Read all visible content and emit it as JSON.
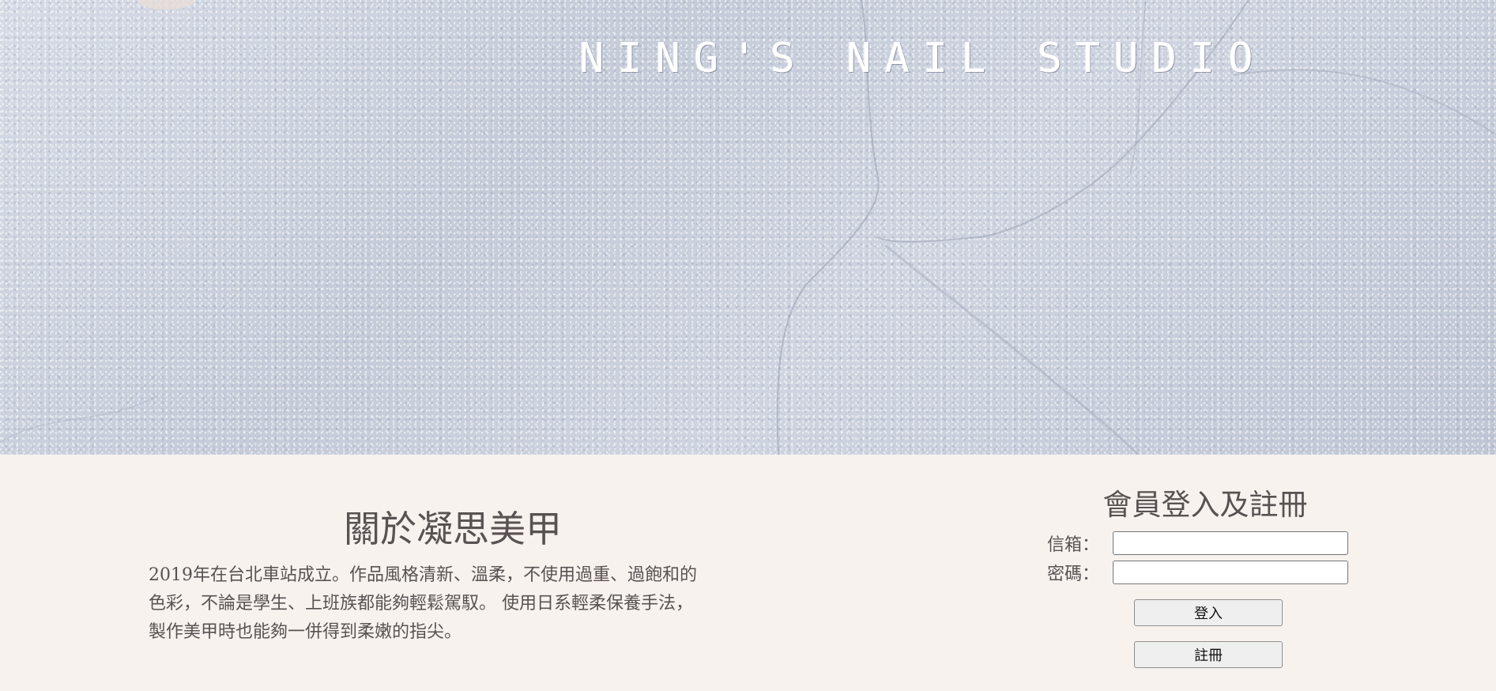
{
  "hero": {
    "title": "NING'S NAIL STUDIO"
  },
  "about": {
    "title": "關於凝思美甲",
    "text_lines": [
      "2019年在台北車站成立。作品風格清新、溫柔，不使用過重、過飽和的",
      "色彩，不論是學生、上班族都能夠輕鬆駕馭。 使用日系輕柔保養手法，",
      "製作美甲時也能夠一併得到柔嫩的指尖。"
    ]
  },
  "member": {
    "title": "會員登入及註冊",
    "email_label": "信箱：",
    "email_value": "",
    "password_label": "密碼：",
    "password_value": "",
    "login_label": "登入",
    "register_label": "註冊"
  },
  "colors": {
    "page_background": "#f8f2ef",
    "text": "#595252",
    "hero_wall": "#c9cfdc"
  }
}
